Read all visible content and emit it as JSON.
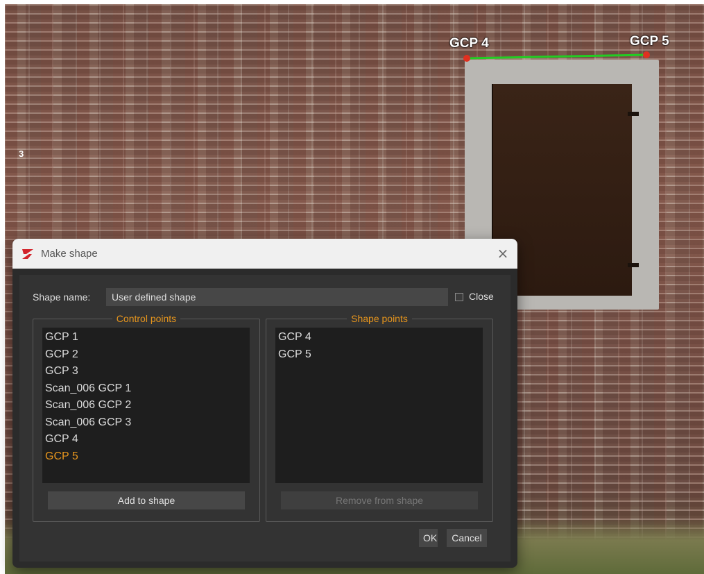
{
  "viewport": {
    "gcp_labels": [
      "GCP  4",
      "GCP  5"
    ],
    "edge_marker": "3",
    "colors": {
      "line": "#22cc22",
      "marker": "#e03020"
    }
  },
  "dialog": {
    "title": "Make shape",
    "icon": "app-logo-icon",
    "close_icon": "×",
    "shape_name_label": "Shape name:",
    "shape_name_value": "User defined shape",
    "close_checkbox_label": "Close",
    "close_checked": false,
    "control_points": {
      "title": "Control points",
      "items": [
        "GCP 1",
        "GCP 2",
        "GCP 3",
        "Scan_006 GCP 1",
        "Scan_006 GCP 2",
        "Scan_006 GCP 3",
        "GCP 4",
        "GCP 5"
      ],
      "selected": "GCP 5",
      "button": "Add to shape"
    },
    "shape_points": {
      "title": "Shape points",
      "items": [
        "GCP 4",
        "GCP 5"
      ],
      "button": "Remove from shape"
    },
    "ok": "OK",
    "cancel": "Cancel",
    "accent_color": "#e6951d"
  }
}
